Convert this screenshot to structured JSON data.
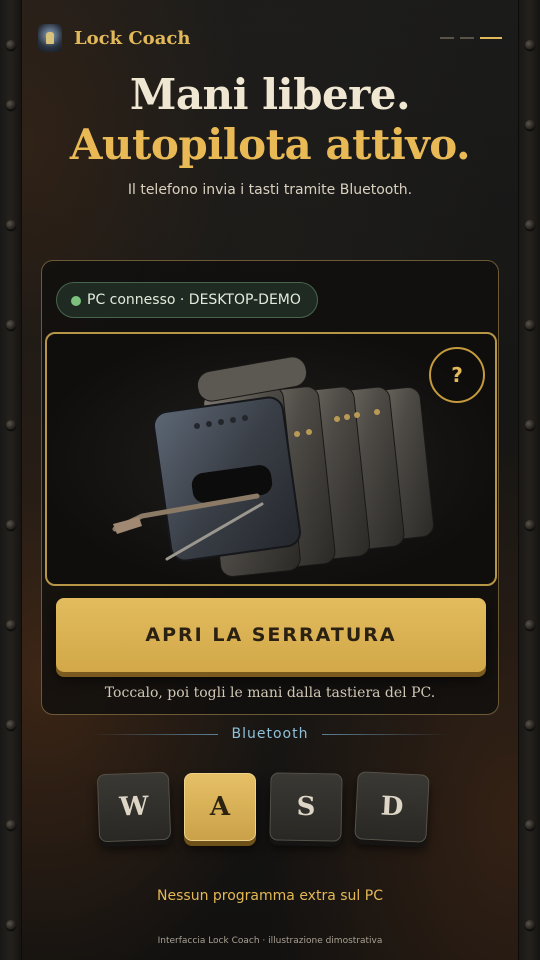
{
  "header": {
    "app_title": "Lock Coach",
    "logo_icon": "keyhole-lock-icon"
  },
  "hero": {
    "line1": "Mani libere.",
    "line2": "Autopilota attivo.",
    "subtitle": "Il telefono invia i tasti tramite Bluetooth."
  },
  "status": {
    "text": "PC connesso · DESKTOP-DEMO",
    "color": "#7cc27e"
  },
  "lock": {
    "image_icon": "pin-tumbler-lock-with-pick-icon",
    "help_label": "?"
  },
  "cta": {
    "label": "APRI LA SERRATURA"
  },
  "hint": "Toccalo, poi togli le mani dalla tastiera del PC.",
  "bluetooth": {
    "label": "Bluetooth"
  },
  "keys": [
    {
      "label": "W",
      "active": false
    },
    {
      "label": "A",
      "active": true
    },
    {
      "label": "S",
      "active": false
    },
    {
      "label": "D",
      "active": false
    }
  ],
  "footer_note": "Nessun programma extra sul PC",
  "caption": "Interfaccia Lock Coach · illustrazione dimostrativa",
  "colors": {
    "accent": "#e2b95a",
    "status_green": "#7cc27e",
    "bluetooth_blue": "#8fc0d8"
  }
}
